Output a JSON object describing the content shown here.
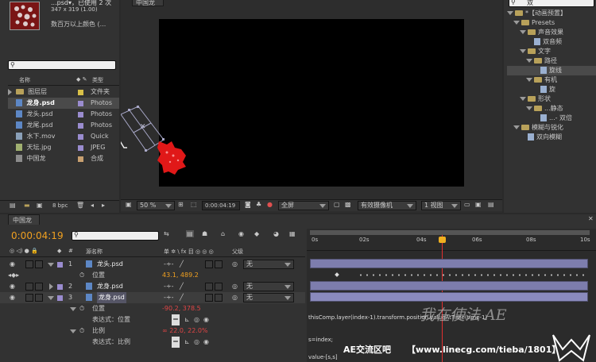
{
  "project": {
    "item_title": "...psd▾，已使用 2 次",
    "item_size": "347 x 319 (1.00)",
    "item_info": "数百万以上颜色 (...",
    "search_placeholder": "",
    "col_name": "名称",
    "col_type": "类型",
    "items": [
      {
        "name": "图层层",
        "type": "文件夹",
        "color": "#d8c048",
        "kind": "folder"
      },
      {
        "name": "龙身.psd",
        "type": "Photos",
        "color": "#9a8ccf",
        "kind": "file"
      },
      {
        "name": "龙头.psd",
        "type": "Photos",
        "color": "#9a8ccf",
        "kind": "file"
      },
      {
        "name": "龙尾.psd",
        "type": "Photos",
        "color": "#9a8ccf",
        "kind": "file"
      },
      {
        "name": "水下.mov",
        "type": "Quick",
        "color": "#9a8ccf",
        "kind": "file"
      },
      {
        "name": "天坛.jpg",
        "type": "JPEG",
        "color": "#9a8ccf",
        "kind": "file"
      },
      {
        "name": "中国龙",
        "type": "合成",
        "color": "#c8a070",
        "kind": "comp"
      }
    ],
    "bpc": "8 bpc"
  },
  "comp_viewer": {
    "tab": "中国龙",
    "zoom": "50 %",
    "timecode": "0:00:04:19",
    "resolution": "全屏",
    "camera": "有效摄像机",
    "views": "1 视图"
  },
  "effects": {
    "search_value": "双",
    "tree": [
      {
        "label": "*【动画预置】",
        "level": 0
      },
      {
        "label": "Presets",
        "level": 1
      },
      {
        "label": "声音效果",
        "level": 2
      },
      {
        "label": "双音频",
        "level": 3
      },
      {
        "label": "文字",
        "level": 2
      },
      {
        "label": "路径",
        "level": 3
      },
      {
        "label": "旋线",
        "level": 4
      },
      {
        "label": "有机",
        "level": 3
      },
      {
        "label": "旋",
        "level": 4
      },
      {
        "label": "形状",
        "level": 2
      },
      {
        "label": "...静态",
        "level": 3
      },
      {
        "label": "...- 双倍",
        "level": 4
      },
      {
        "label": "模糊与锐化",
        "level": 1
      },
      {
        "label": "双向模糊",
        "level": 2
      }
    ]
  },
  "timeline": {
    "tab": "中国龙",
    "timecode": "0:00:04:19",
    "search_placeholder": "",
    "col_num": "#",
    "col_source": "源名称",
    "col_switches": "单 ✲ \\ fx 目 ◎ ◎ ◎",
    "col_parent": "父级",
    "layers": [
      {
        "num": "1",
        "name": "龙头.psd",
        "parent": "无"
      },
      {
        "num": "2",
        "name": "龙身.psd",
        "parent": "无"
      },
      {
        "num": "3",
        "name": "龙身.psd",
        "parent": "无"
      }
    ],
    "props": {
      "pos1_label": "位置",
      "pos1_value": "43.1, 489.2",
      "pos3_label": "位置",
      "pos3_value": "-90.2, 378.5",
      "expr_pos_label": "表达式：位置",
      "scale_label": "比例",
      "scale_value": "∞ 22.0, 22.0%",
      "expr_scale_label": "表达式：比例"
    },
    "ruler": [
      "0s",
      "02s",
      "04s",
      "06s",
      "08s",
      "10s"
    ],
    "expr_line1": "thisComp.layer(index-1).transform.position.valueAtTime(time-1)",
    "expr_line2": "s=index;",
    "expr_line3": "value-[s,s]"
  },
  "watermark": {
    "forum": "AE交流区吧",
    "url": "【www.linecg.com/tieba/1801】",
    "handwriting": "我在使法 AE"
  }
}
